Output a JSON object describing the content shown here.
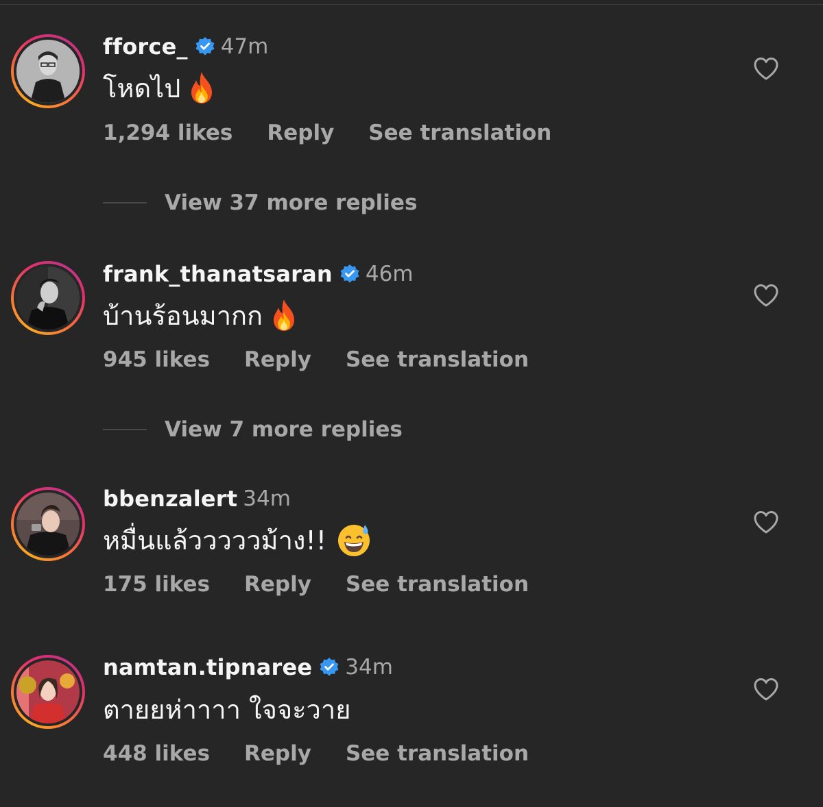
{
  "colors": {
    "background": "#262627",
    "primary_text": "#f5f5f5",
    "secondary_text": "#a8a8a8",
    "verified_blue": "#3897f0"
  },
  "comments": [
    {
      "username": "fforce_",
      "verified": true,
      "time": "47m",
      "text": "โหดไป",
      "emoji": "fire",
      "likes": "1,294 likes",
      "reply": "Reply",
      "translate": "See translation",
      "view_more": "View 37 more replies"
    },
    {
      "username": "frank_thanatsaran",
      "verified": true,
      "time": "46m",
      "text": "บ้านร้อนมากก",
      "emoji": "fire",
      "likes": "945 likes",
      "reply": "Reply",
      "translate": "See translation",
      "view_more": "View 7 more replies"
    },
    {
      "username": "bbenzalert",
      "verified": false,
      "time": "34m",
      "text": "หมื่นแล้วววววม้าง!!",
      "emoji": "grinning-sweat",
      "likes": "175 likes",
      "reply": "Reply",
      "translate": "See translation"
    },
    {
      "username": "namtan.tipnaree",
      "verified": true,
      "time": "34m",
      "text": "ตายยห่าาาา ใจจะวาย",
      "likes": "448 likes",
      "reply": "Reply",
      "translate": "See translation"
    }
  ]
}
